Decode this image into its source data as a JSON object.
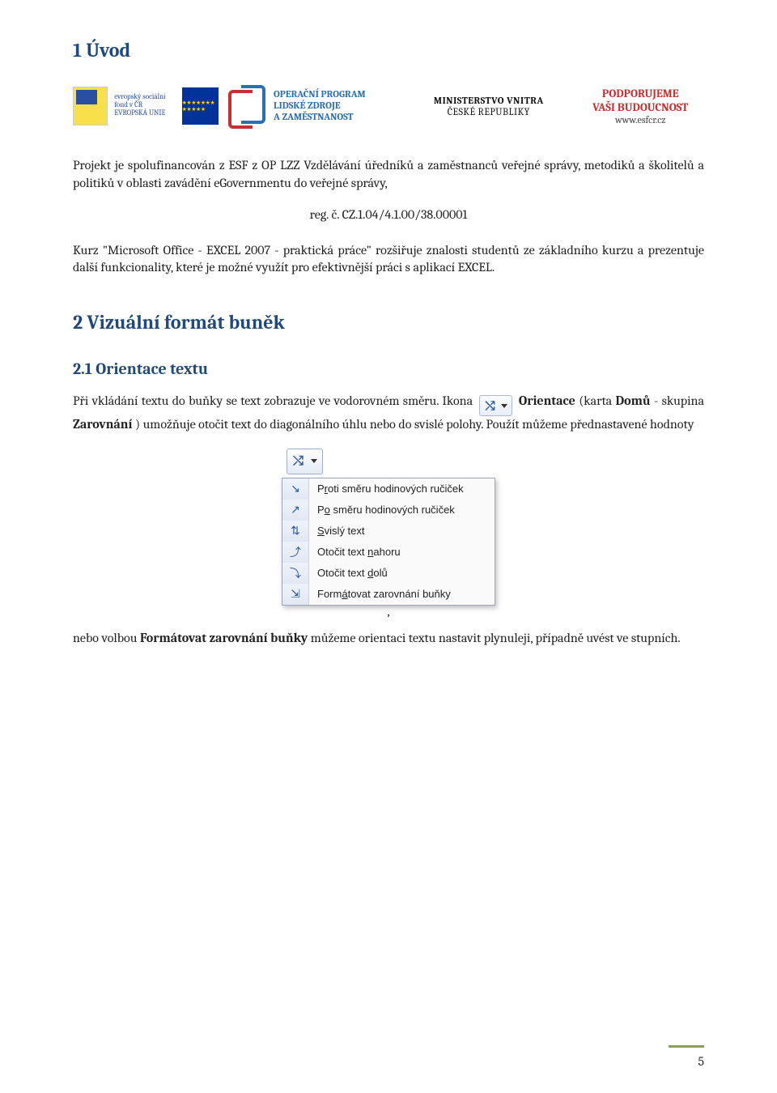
{
  "sections": {
    "intro_heading": "1   Úvod",
    "visual_heading": "2   Vizuální formát buněk",
    "orient_heading": "2.1   Orientace textu"
  },
  "banner": {
    "esf_small": "evropský\nsociální\nfond v ČR",
    "esf_eu": "EVROPSKÁ UNIE",
    "oplzz_l1": "OPERAČNÍ PROGRAM",
    "oplzz_l2": "LIDSKÉ ZDROJE",
    "oplzz_l3": "A ZAMĚSTNANOST",
    "mvcr_l1": "MINISTERSTVO VNITRA",
    "mvcr_l2": "ČESKÉ REPUBLIKY",
    "podp_l1": "PODPORUJEME",
    "podp_l2": "VAŠI BUDOUCNOST",
    "podp_l3": "www.esfcr.cz"
  },
  "paragraphs": {
    "p1": "Projekt je spolufinancován z ESF z OP LZZ Vzdělávání úředníků a zaměstnanců veřejné správy, metodiků a školitelů a politiků v oblasti zavádění eGovernmentu do veřejné správy,",
    "reg": "reg. č. CZ.1.04/4.1.00/38.00001",
    "p2": "Kurz \"Microsoft Office - EXCEL 2007 - praktická práce\" rozšiřuje znalosti studentů ze základního kurzu a prezentuje další funkcionality, které je možné využít pro efektivnější práci s aplikací EXCEL.",
    "p3_a": "Při vkládání textu do buňky se text zobrazuje ve vodorovném směru. Ikona ",
    "p3_b_bold": "Orientace",
    "p3_c": " (karta ",
    "p3_d_bold": "Domů",
    "p3_e": " - skupina ",
    "p3_f_bold": "Zarovnání",
    "p3_g": ") umožňuje otočit text do diagonálního úhlu nebo do svislé polohy. Použít můžeme přednastavené hodnoty",
    "p4_a": "nebo volbou ",
    "p4_b_bold": "Formátovat zarovnání buňky",
    "p4_c": " můžeme orientaci textu nastavit plynuleji, případně uvést ve stupních."
  },
  "menu": {
    "items": [
      {
        "icon": "↘",
        "html": "P<u>r</u>oti směru hodinových ručiček"
      },
      {
        "icon": "↗",
        "html": "P<u>o</u> směru hodinových ručiček"
      },
      {
        "icon": "⇅",
        "html": "<u>S</u>vislý text"
      },
      {
        "icon": "⤴",
        "html": "Otočit text <u>n</u>ahoru"
      },
      {
        "icon": "⤵",
        "html": "Otočit text <u>d</u>olů"
      },
      {
        "icon": "⇲",
        "html": "Form<u>á</u>tovat zarovnání buňky"
      }
    ]
  },
  "page_number": "5"
}
